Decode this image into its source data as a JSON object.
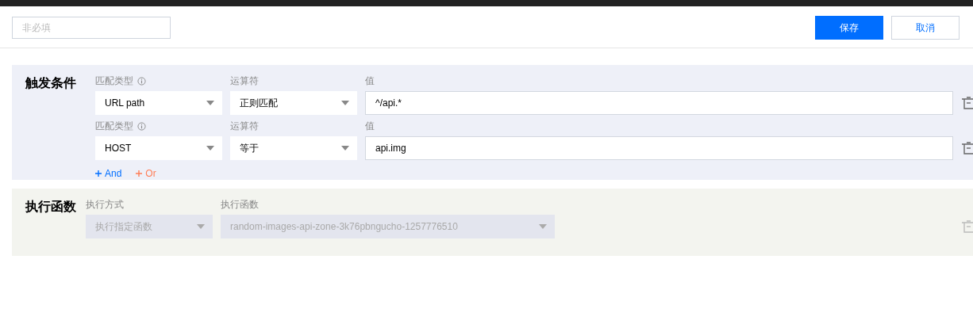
{
  "header": {
    "name_field": {
      "placeholder": "非必填"
    },
    "buttons": [
      {
        "label": "保存",
        "kind": "primary"
      },
      {
        "label": "取消",
        "kind": "secondary"
      }
    ]
  },
  "trigger": {
    "title": "触发条件",
    "conditions": [
      {
        "match_type_label": "匹配类型",
        "match_type": "URL path",
        "operator_label": "运算符",
        "operator": "正则匹配",
        "value_label": "值",
        "value": "^/api.*"
      },
      {
        "match_type_label": "匹配类型",
        "match_type": "HOST",
        "operator_label": "运算符",
        "operator": "等于",
        "value_label": "值",
        "value": "api.img"
      }
    ],
    "add_links": [
      {
        "label": "And",
        "color": "#006eff"
      },
      {
        "label": "Or",
        "color": "#ff7d56"
      }
    ]
  },
  "execute": {
    "title": "执行函数",
    "disabled": true,
    "mode_label": "执行方式",
    "mode": "执行指定函数",
    "function_label": "执行函数",
    "function": "random-images-api-zone-3k76pbngucho-1257776510"
  }
}
